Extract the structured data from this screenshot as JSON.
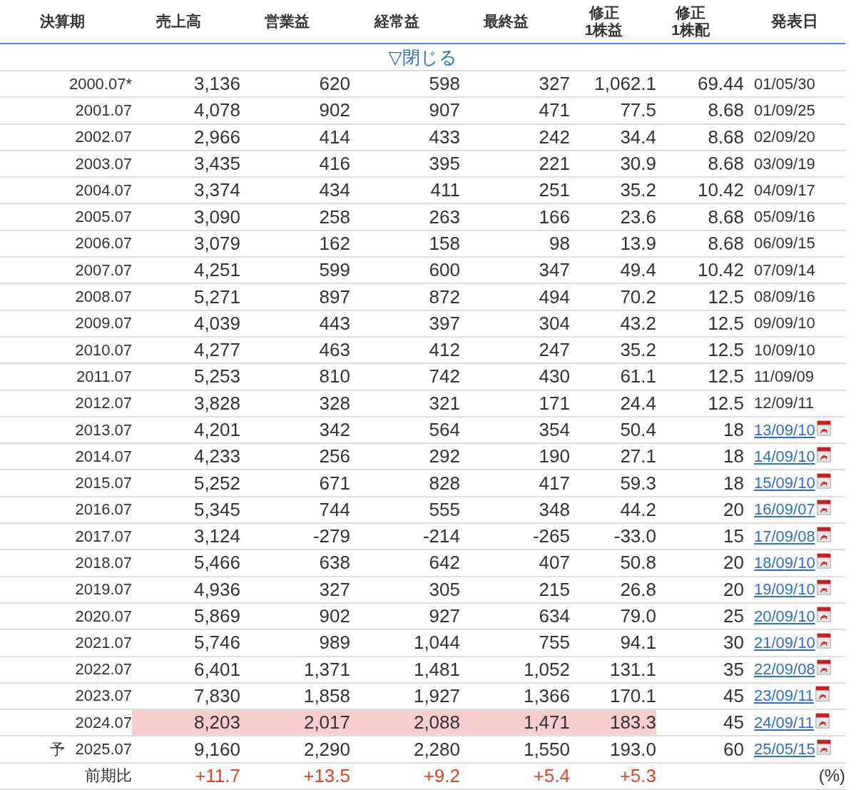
{
  "columns": [
    {
      "label": "決算期"
    },
    {
      "label": "売上高"
    },
    {
      "label": "営業益"
    },
    {
      "label": "経常益"
    },
    {
      "label": "最終益"
    },
    {
      "label": "修正\n1株益"
    },
    {
      "label": "修正\n1株配"
    },
    {
      "label": "発表日"
    }
  ],
  "toggle": "▽閉じる",
  "rows": [
    {
      "period": "2000.07*",
      "values": [
        "3,136",
        "620",
        "598",
        "327",
        "1,062.1",
        "69.44"
      ],
      "date": "01/05/30",
      "link": false,
      "highlighted": false
    },
    {
      "period": "2001.07",
      "values": [
        "4,078",
        "902",
        "907",
        "471",
        "77.5",
        "8.68"
      ],
      "date": "01/09/25",
      "link": false,
      "highlighted": false
    },
    {
      "period": "2002.07",
      "values": [
        "2,966",
        "414",
        "433",
        "242",
        "34.4",
        "8.68"
      ],
      "date": "02/09/20",
      "link": false,
      "highlighted": false
    },
    {
      "period": "2003.07",
      "values": [
        "3,435",
        "416",
        "395",
        "221",
        "30.9",
        "8.68"
      ],
      "date": "03/09/19",
      "link": false,
      "highlighted": false
    },
    {
      "period": "2004.07",
      "values": [
        "3,374",
        "434",
        "411",
        "251",
        "35.2",
        "10.42"
      ],
      "date": "04/09/17",
      "link": false,
      "highlighted": false
    },
    {
      "period": "2005.07",
      "values": [
        "3,090",
        "258",
        "263",
        "166",
        "23.6",
        "8.68"
      ],
      "date": "05/09/16",
      "link": false,
      "highlighted": false
    },
    {
      "period": "2006.07",
      "values": [
        "3,079",
        "162",
        "158",
        "98",
        "13.9",
        "8.68"
      ],
      "date": "06/09/15",
      "link": false,
      "highlighted": false
    },
    {
      "period": "2007.07",
      "values": [
        "4,251",
        "599",
        "600",
        "347",
        "49.4",
        "10.42"
      ],
      "date": "07/09/14",
      "link": false,
      "highlighted": false
    },
    {
      "period": "2008.07",
      "values": [
        "5,271",
        "897",
        "872",
        "494",
        "70.2",
        "12.5"
      ],
      "date": "08/09/16",
      "link": false,
      "highlighted": false
    },
    {
      "period": "2009.07",
      "values": [
        "4,039",
        "443",
        "397",
        "304",
        "43.2",
        "12.5"
      ],
      "date": "09/09/10",
      "link": false,
      "highlighted": false
    },
    {
      "period": "2010.07",
      "values": [
        "4,277",
        "463",
        "412",
        "247",
        "35.2",
        "12.5"
      ],
      "date": "10/09/10",
      "link": false,
      "highlighted": false
    },
    {
      "period": "2011.07",
      "values": [
        "5,253",
        "810",
        "742",
        "430",
        "61.1",
        "12.5"
      ],
      "date": "11/09/09",
      "link": false,
      "highlighted": false
    },
    {
      "period": "2012.07",
      "values": [
        "3,828",
        "328",
        "321",
        "171",
        "24.4",
        "12.5"
      ],
      "date": "12/09/11",
      "link": false,
      "highlighted": false
    },
    {
      "period": "2013.07",
      "values": [
        "4,201",
        "342",
        "564",
        "354",
        "50.4",
        "18"
      ],
      "date": "13/09/10",
      "link": true,
      "highlighted": false
    },
    {
      "period": "2014.07",
      "values": [
        "4,233",
        "256",
        "292",
        "190",
        "27.1",
        "18"
      ],
      "date": "14/09/10",
      "link": true,
      "highlighted": false
    },
    {
      "period": "2015.07",
      "values": [
        "5,252",
        "671",
        "828",
        "417",
        "59.3",
        "18"
      ],
      "date": "15/09/10",
      "link": true,
      "highlighted": false
    },
    {
      "period": "2016.07",
      "values": [
        "5,345",
        "744",
        "555",
        "348",
        "44.2",
        "20"
      ],
      "date": "16/09/07",
      "link": true,
      "highlighted": false
    },
    {
      "period": "2017.07",
      "values": [
        "3,124",
        "-279",
        "-214",
        "-265",
        "-33.0",
        "15"
      ],
      "date": "17/09/08",
      "link": true,
      "highlighted": false
    },
    {
      "period": "2018.07",
      "values": [
        "5,466",
        "638",
        "642",
        "407",
        "50.8",
        "20"
      ],
      "date": "18/09/10",
      "link": true,
      "highlighted": false
    },
    {
      "period": "2019.07",
      "values": [
        "4,936",
        "327",
        "305",
        "215",
        "26.8",
        "20"
      ],
      "date": "19/09/10",
      "link": true,
      "highlighted": false
    },
    {
      "period": "2020.07",
      "values": [
        "5,869",
        "902",
        "927",
        "634",
        "79.0",
        "25"
      ],
      "date": "20/09/10",
      "link": true,
      "highlighted": false
    },
    {
      "period": "2021.07",
      "values": [
        "5,746",
        "989",
        "1,044",
        "755",
        "94.1",
        "30"
      ],
      "date": "21/09/10",
      "link": true,
      "highlighted": false
    },
    {
      "period": "2022.07",
      "values": [
        "6,401",
        "1,371",
        "1,481",
        "1,052",
        "131.1",
        "35"
      ],
      "date": "22/09/08",
      "link": true,
      "highlighted": false
    },
    {
      "period": "2023.07",
      "values": [
        "7,830",
        "1,858",
        "1,927",
        "1,366",
        "170.1",
        "45"
      ],
      "date": "23/09/11",
      "link": true,
      "highlighted": false
    },
    {
      "period": "2024.07",
      "values": [
        "8,203",
        "2,017",
        "2,088",
        "1,471",
        "183.3",
        "45"
      ],
      "date": "24/09/11",
      "link": true,
      "highlighted": true
    },
    {
      "period": "2025.07",
      "forecast_mark": "予",
      "values": [
        "9,160",
        "2,290",
        "2,280",
        "1,550",
        "193.0",
        "60"
      ],
      "date": "25/05/15",
      "link": true,
      "highlighted": false
    }
  ],
  "change_row": {
    "label": "前期比",
    "values": [
      "+11.7",
      "+13.5",
      "+9.2",
      "+5.4",
      "+5.3"
    ],
    "unit": "(%)"
  }
}
